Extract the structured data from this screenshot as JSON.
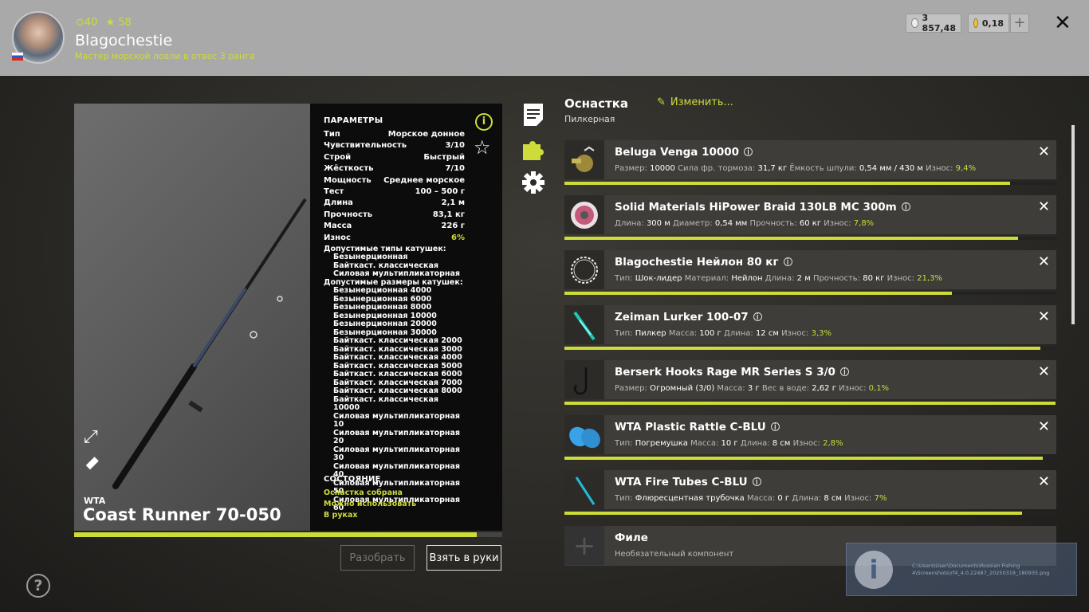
{
  "header": {
    "level": "40",
    "rating": "58",
    "player_name": "Blagochestie",
    "rank_title": "Мастер морской ловли в отвес 3 ранга",
    "silver": "3 857,48",
    "gold": "0,18"
  },
  "rod": {
    "brand": "WTA",
    "title": "Coast Runner 70-050",
    "params_title": "ПАРАМЕТРЫ",
    "params": [
      {
        "k": "Тип",
        "v": "Морское донное"
      },
      {
        "k": "Чувствительность",
        "v": "3/10"
      },
      {
        "k": "Строй",
        "v": "Быстрый"
      },
      {
        "k": "Жёсткость",
        "v": "7/10"
      },
      {
        "k": "Мощность",
        "v": "Среднее морское"
      },
      {
        "k": "Тест",
        "v": "100 – 500 г"
      },
      {
        "k": "Длина",
        "v": "2,1 м"
      },
      {
        "k": "Прочность",
        "v": "83,1 кг"
      },
      {
        "k": "Масса",
        "v": "226 г"
      },
      {
        "k": "Износ",
        "v": "6%"
      }
    ],
    "reel_types_title": "Допустимые типы катушек:",
    "reel_types": [
      "Безынерционная",
      "Байткаст. классическая",
      "Силовая мультипликаторная"
    ],
    "reel_sizes_title": "Допустимые размеры катушек:",
    "reel_sizes": [
      "Безынерционная 4000",
      "Безынерционная 6000",
      "Безынерционная 8000",
      "Безынерционная 10000",
      "Безынерционная 20000",
      "Безынерционная 30000",
      "Байткаст. классическая 2000",
      "Байткаст. классическая 3000",
      "Байткаст. классическая 4000",
      "Байткаст. классическая 5000",
      "Байткаст. классическая 6000",
      "Байткаст. классическая 7000",
      "Байткаст. классическая 8000",
      "Байткаст. классическая 10000",
      "Силовая мультипликаторная 10",
      "Силовая мультипликаторная 20",
      "Силовая мультипликаторная 30",
      "Силовая мультипликаторная 40",
      "Силовая мультипликаторная 50",
      "Силовая мультипликаторная 60"
    ],
    "status_title": "СОСТОЯНИЕ",
    "status": [
      "Оснастка собрана",
      "Можно использовать",
      "В руках"
    ],
    "condition": 0.94,
    "btn_disassemble": "Разобрать",
    "btn_take": "Взять в руки"
  },
  "gear": {
    "title": "Оснастка",
    "subtitle": "Пилкерная",
    "edit_label": "Изменить...",
    "items": [
      {
        "name": "Beluga Venga 10000",
        "parts": [
          [
            "Размер:",
            "10000"
          ],
          [
            "Сила фр. тормоза:",
            "31,7 кг"
          ],
          [
            "Ёмкость шпули:",
            "0,54 мм / 430 м"
          ]
        ],
        "wear_label": "Износ:",
        "wear": "9,4%",
        "condition": 0.906
      },
      {
        "name": "Solid Materials HiPower Braid 130LB MC 300m",
        "parts": [
          [
            "Длина:",
            "300 м"
          ],
          [
            "Диаметр:",
            "0,54 мм"
          ],
          [
            "Прочность:",
            "60 кг"
          ]
        ],
        "wear_label": "Износ:",
        "wear": "7,8%",
        "condition": 0.922
      },
      {
        "name": "Blagochestie Нейлон 80 кг",
        "parts": [
          [
            "Тип:",
            "Шок-лидер"
          ],
          [
            "Материал:",
            "Нейлон"
          ],
          [
            "Длина:",
            "2 м"
          ],
          [
            "Прочность:",
            "80 кг"
          ]
        ],
        "wear_label": "Износ:",
        "wear": "21,3%",
        "condition": 0.787
      },
      {
        "name": "Zeiman Lurker 100-07",
        "parts": [
          [
            "Тип:",
            "Пилкер"
          ],
          [
            "Масса:",
            "100 г"
          ],
          [
            "Длина:",
            "12 см"
          ]
        ],
        "wear_label": "Износ:",
        "wear": "3,3%",
        "condition": 0.967
      },
      {
        "name": "Berserk Hooks Rage MR Series S 3/0",
        "parts": [
          [
            "Размер:",
            "Огромный (3/0)"
          ],
          [
            "Масса:",
            "3 г"
          ],
          [
            "Вес в воде:",
            "2,62 г"
          ]
        ],
        "wear_label": "Износ:",
        "wear": "0,1%",
        "condition": 0.999
      },
      {
        "name": "WTA Plastic Rattle C-BLU",
        "parts": [
          [
            "Тип:",
            "Погремушка"
          ],
          [
            "Масса:",
            "10 г"
          ],
          [
            "Длина:",
            "8 см"
          ]
        ],
        "wear_label": "Износ:",
        "wear": "2,8%",
        "condition": 0.972
      },
      {
        "name": "WTA Fire Tubes C-BLU",
        "parts": [
          [
            "Тип:",
            "Флюресцентная трубочка"
          ],
          [
            "Масса:",
            "0 г"
          ],
          [
            "Длина:",
            "8 см"
          ]
        ],
        "wear_label": "Износ:",
        "wear": "7%",
        "condition": 0.93
      }
    ],
    "optional": {
      "name": "Филе",
      "desc": "Необязательный компонент"
    }
  },
  "notification": {
    "path_line1": "C:\\Users\\User\\Documents\\Russian Fishing",
    "path_line2": "4\\Screenshots\\rf4_4.0.22487_20250318_180935.png"
  },
  "icons": [
    "user-avatar",
    "level-icon",
    "star-rating-icon",
    "silver-coin-icon",
    "gold-coin-icon",
    "plus-icon",
    "close-icon",
    "info-icon",
    "favorite-star-icon",
    "notes-icon",
    "puzzle-icon",
    "gear-settings-icon",
    "expand-icon",
    "rod-icon",
    "edit-pencil-icon",
    "help-icon",
    "remove-icon",
    "add-component-icon"
  ],
  "colors": {
    "accent": "#cddc39",
    "header_bg": "#a9a9a9",
    "panel_bg": "#0c0c0c",
    "item_bg": "#3e3d39"
  }
}
